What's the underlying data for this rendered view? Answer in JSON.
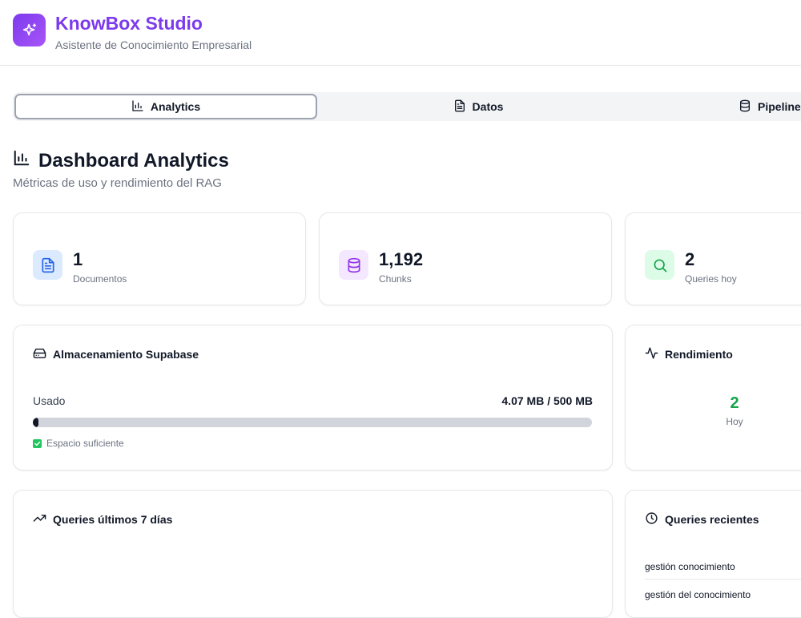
{
  "app": {
    "title": "KnowBox Studio",
    "subtitle": "Asistente de Conocimiento Empresarial"
  },
  "tabs": [
    {
      "label": "Analytics",
      "icon": "bar-chart-icon",
      "active": true
    },
    {
      "label": "Datos",
      "icon": "file-text-icon",
      "active": false
    },
    {
      "label": "Pipeline",
      "icon": "database-icon",
      "active": false
    }
  ],
  "dashboard": {
    "title": "Dashboard Analytics",
    "subtitle": "Métricas de uso y rendimiento del RAG"
  },
  "stats": [
    {
      "value": "1",
      "label": "Documentos",
      "icon": "file-text-icon",
      "color": "#2563eb",
      "bg": "#dbeafe"
    },
    {
      "value": "1,192",
      "label": "Chunks",
      "icon": "database-icon",
      "color": "#9333ea",
      "bg": "#f3e8ff"
    },
    {
      "value": "2",
      "label": "Queries hoy",
      "icon": "search-icon",
      "color": "#16a34a",
      "bg": "#dcfce7"
    }
  ],
  "storage": {
    "title": "Almacenamiento Supabase",
    "used_label": "Usado",
    "used_value": "4.07 MB / 500 MB",
    "used_fraction": 0.00814,
    "status": "Espacio suficiente"
  },
  "performance": {
    "title": "Rendimiento",
    "value": "2",
    "label": "Hoy",
    "color": "#16a34a"
  },
  "queries_chart": {
    "title": "Queries últimos 7 días"
  },
  "recent": {
    "title": "Queries recientes",
    "items": [
      "gestión conocimiento",
      "gestión del conocimiento"
    ]
  }
}
